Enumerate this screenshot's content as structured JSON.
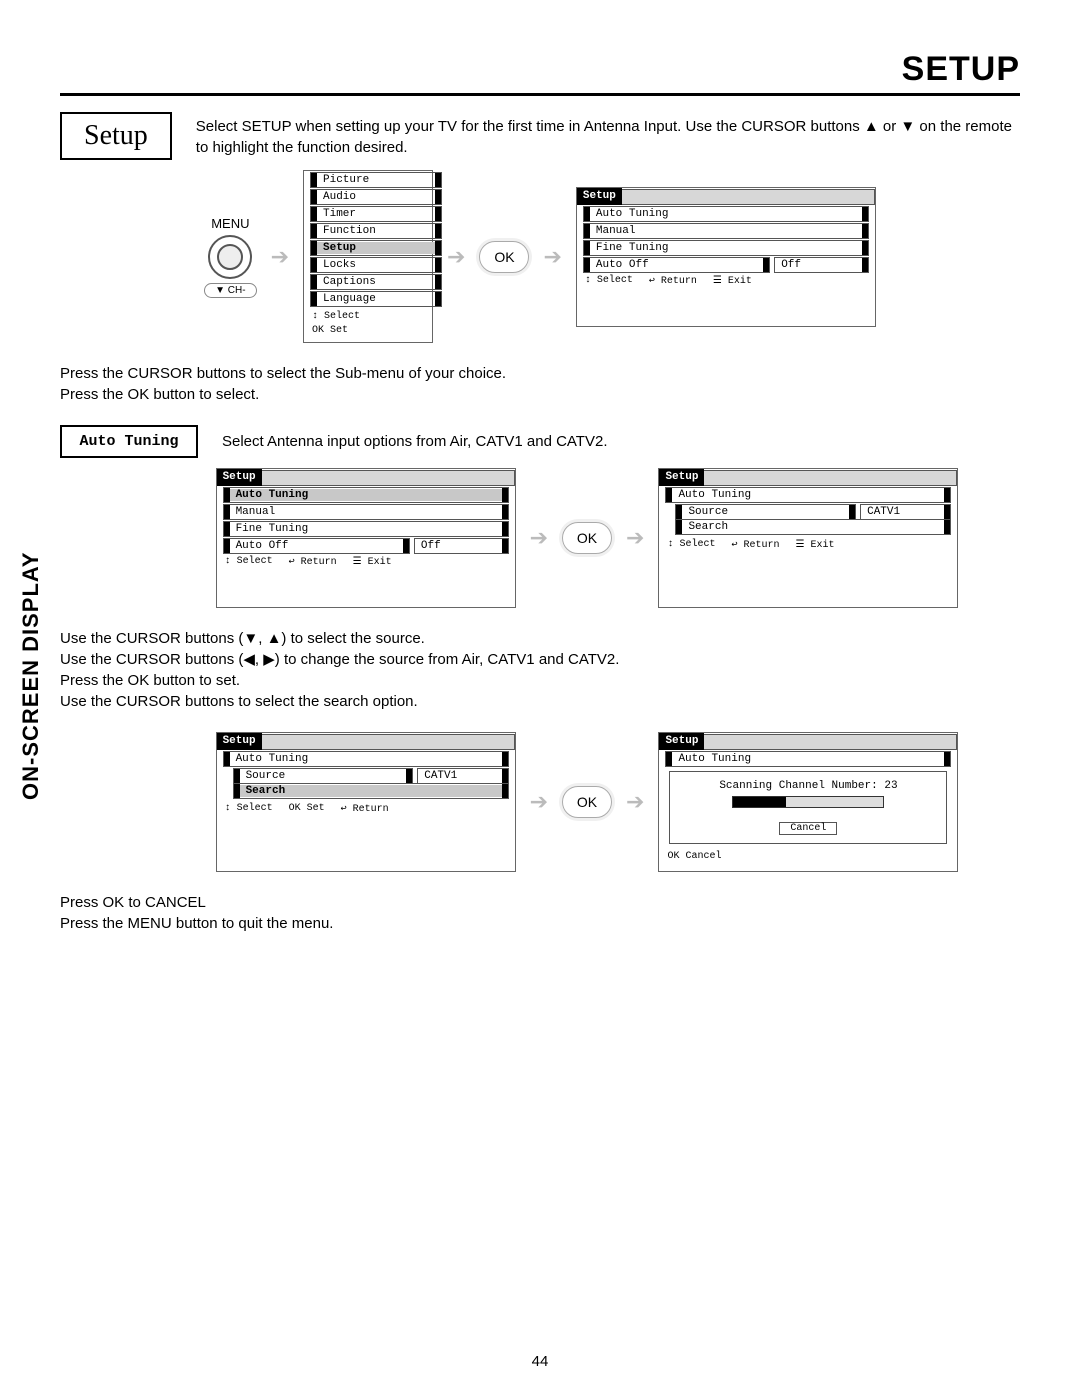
{
  "header": {
    "title": "SETUP"
  },
  "sidebar": {
    "label": "ON-SCREEN DISPLAY"
  },
  "setup_box": {
    "label": "Setup"
  },
  "intro": "Select SETUP when setting up your TV for the first time in Antenna Input.  Use the CURSOR buttons ▲ or ▼ on the remote to highlight the function desired.",
  "menu_label": "MENU",
  "ch_button": "▼ CH-",
  "ok_label": "OK",
  "main_menu": {
    "items": [
      "Picture",
      "Audio",
      "Timer",
      "Function",
      "Setup",
      "Locks",
      "Captions",
      "Language"
    ],
    "selected": "Setup",
    "hints": {
      "select": "↕ Select",
      "set": "OK Set"
    }
  },
  "setup_menu": {
    "title": "Setup",
    "items": [
      "Auto Tuning",
      "Manual",
      "Fine Tuning"
    ],
    "auto_off": {
      "label": "Auto Off",
      "value": "Off"
    },
    "hints": {
      "select": "↕ Select",
      "return": "↩ Return",
      "exit": "☰ Exit"
    }
  },
  "text_after_menus": "Press the CURSOR buttons to select the Sub-menu of your choice.\nPress the OK button to select.",
  "auto_tuning_box": {
    "label": "Auto Tuning"
  },
  "auto_tuning_desc": "Select Antenna input options from Air, CATV1 and CATV2.",
  "setup_menu_sel": {
    "title": "Setup",
    "items": [
      "Auto Tuning",
      "Manual",
      "Fine Tuning"
    ],
    "selected": "Auto Tuning",
    "auto_off": {
      "label": "Auto Off",
      "value": "Off"
    },
    "hints": {
      "select": "↕ Select",
      "return": "↩ Return",
      "exit": "☰ Exit"
    }
  },
  "auto_tuning_menu": {
    "title": "Setup",
    "breadcrumb": "Auto Tuning",
    "source": {
      "label": "Source",
      "value": "CATV1"
    },
    "search": "Search",
    "hints": {
      "select": "↕ Select",
      "return": "↩ Return",
      "exit": "☰ Exit"
    }
  },
  "text_after_auto": "Use the CURSOR buttons (▼, ▲) to select the source.\nUse the CURSOR buttons (◀, ▶) to change the source from Air, CATV1 and CATV2.\nPress the OK button to set.\nUse the CURSOR buttons to select the search option.",
  "search_menu": {
    "title": "Setup",
    "breadcrumb": "Auto Tuning",
    "source": {
      "label": "Source",
      "value": "CATV1"
    },
    "search": "Search",
    "selected": "Search",
    "hints": {
      "select": "↕ Select",
      "set": "OK Set",
      "return": "↩ Return"
    }
  },
  "scanning": {
    "title": "Setup",
    "breadcrumb": "Auto Tuning",
    "text": "Scanning Channel Number: 23",
    "cancel": "Cancel",
    "hint": "OK Cancel"
  },
  "text_final": "Press OK to CANCEL\nPress the MENU button to quit the menu.",
  "page_number": "44"
}
